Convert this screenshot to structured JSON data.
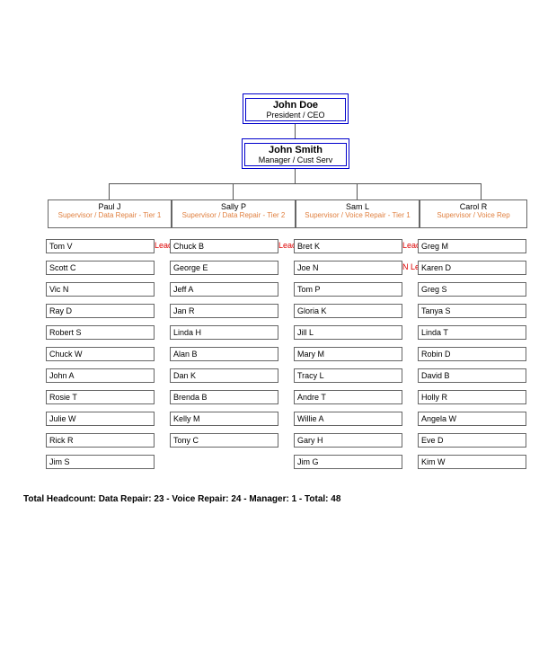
{
  "ceo": {
    "name": "John Doe",
    "title": "President / CEO"
  },
  "manager": {
    "name": "John Smith",
    "title": "Manager / Cust Serv"
  },
  "supervisors": [
    {
      "name": "Paul J",
      "title": "Supervisor / Data Repair - Tier 1"
    },
    {
      "name": "Sally P",
      "title": "Supervisor / Data Repair - Tier 2"
    },
    {
      "name": "Sam L",
      "title": "Supervisor / Voice Repair - Tier 1"
    },
    {
      "name": "Carol R",
      "title": "Supervisor / Voice Rep"
    }
  ],
  "teams": [
    {
      "employees": [
        {
          "name": "Tom V",
          "role": "Lead"
        },
        {
          "name": "Scott C"
        },
        {
          "name": "Vic N"
        },
        {
          "name": "Ray D"
        },
        {
          "name": "Robert S"
        },
        {
          "name": "Chuck W"
        },
        {
          "name": "John A"
        },
        {
          "name": "Rosie T"
        },
        {
          "name": "Julie W"
        },
        {
          "name": "Rick R"
        },
        {
          "name": "Jim S"
        }
      ]
    },
    {
      "employees": [
        {
          "name": "Chuck B",
          "role": "Lead"
        },
        {
          "name": "George E"
        },
        {
          "name": "Jeff A"
        },
        {
          "name": "Jan R"
        },
        {
          "name": "Linda H"
        },
        {
          "name": "Alan B"
        },
        {
          "name": "Dan K"
        },
        {
          "name": "Brenda B"
        },
        {
          "name": "Kelly M"
        },
        {
          "name": "Tony C"
        }
      ]
    },
    {
      "employees": [
        {
          "name": "Bret K",
          "role": "Lead"
        },
        {
          "name": "Joe N",
          "role": "N Lead"
        },
        {
          "name": "Tom P"
        },
        {
          "name": "Gloria K"
        },
        {
          "name": "Jill L"
        },
        {
          "name": "Mary M"
        },
        {
          "name": "Tracy L"
        },
        {
          "name": "Andre T"
        },
        {
          "name": "Willie A"
        },
        {
          "name": "Gary H"
        },
        {
          "name": "Jim G"
        }
      ]
    },
    {
      "employees": [
        {
          "name": "Greg M"
        },
        {
          "name": "Karen D"
        },
        {
          "name": "Greg S"
        },
        {
          "name": "Tanya S"
        },
        {
          "name": "Linda T"
        },
        {
          "name": "Robin D"
        },
        {
          "name": "David B"
        },
        {
          "name": "Holly R"
        },
        {
          "name": "Angela W"
        },
        {
          "name": "Eve D"
        },
        {
          "name": "Kim W"
        }
      ]
    }
  ],
  "summary": "Total Headcount:  Data Repair: 23  -  Voice Repair: 24  -  Manager: 1  -  Total: 48"
}
